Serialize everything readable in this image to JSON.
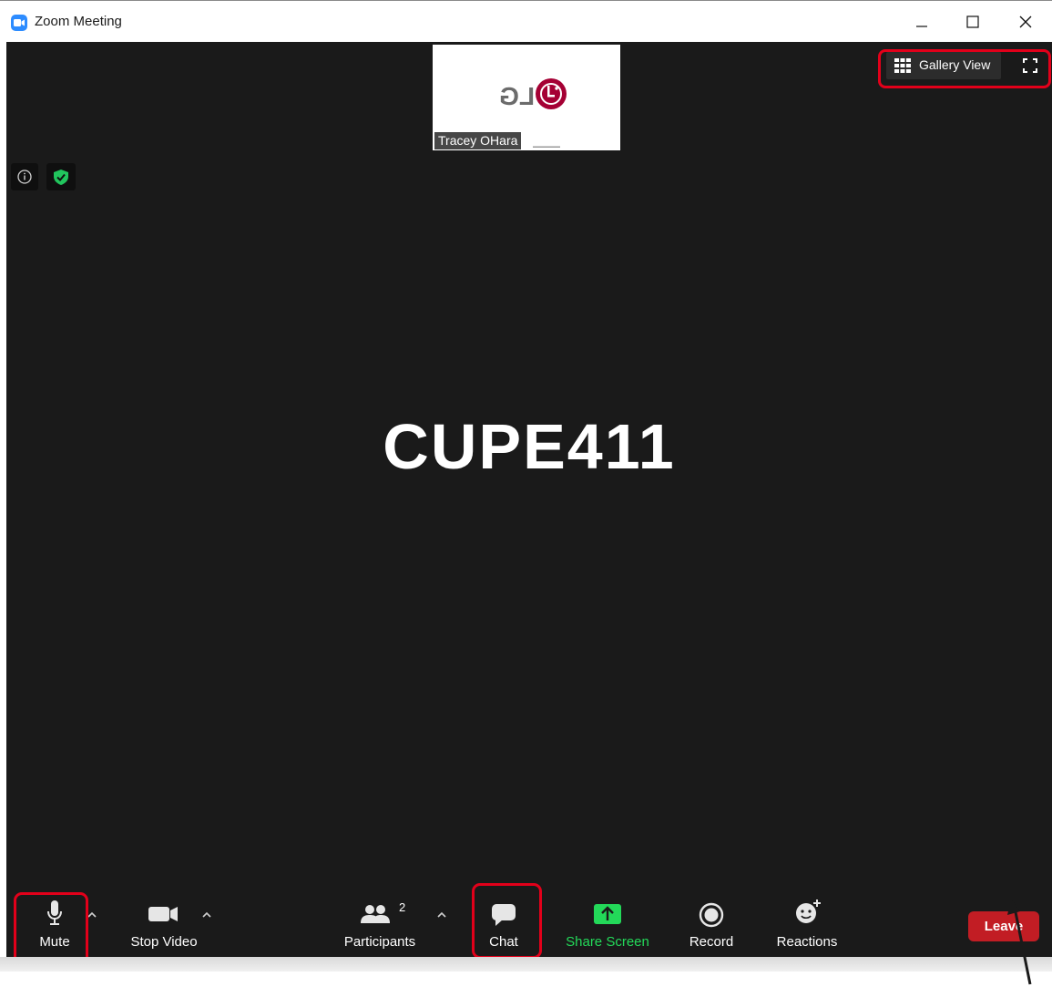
{
  "window": {
    "title": "Zoom Meeting",
    "icon": "zoom-camera-icon",
    "controls": [
      "minimize-icon",
      "maximize-icon",
      "close-icon"
    ]
  },
  "video_tile": {
    "participant_name": "Tracey OHara",
    "logo_text": "LG",
    "logo_color": "#a50034"
  },
  "top_bar": {
    "gallery_view_label": "Gallery View",
    "fullscreen_icon": "fullscreen-icon"
  },
  "status_icons": {
    "info": "info-icon",
    "encryption": "shield-check-icon",
    "encryption_color": "#21c55d"
  },
  "main": {
    "display_name": "CUPE411"
  },
  "toolbar": {
    "mute_label": "Mute",
    "stop_video_label": "Stop Video",
    "participants_label": "Participants",
    "participants_count": "2",
    "chat_label": "Chat",
    "share_screen_label": "Share Screen",
    "share_screen_color": "#23d959",
    "record_label": "Record",
    "reactions_label": "Reactions",
    "leave_label": "Leave",
    "leave_color": "#c21d24"
  },
  "annotations": {
    "callout_color": "#e2001a"
  }
}
